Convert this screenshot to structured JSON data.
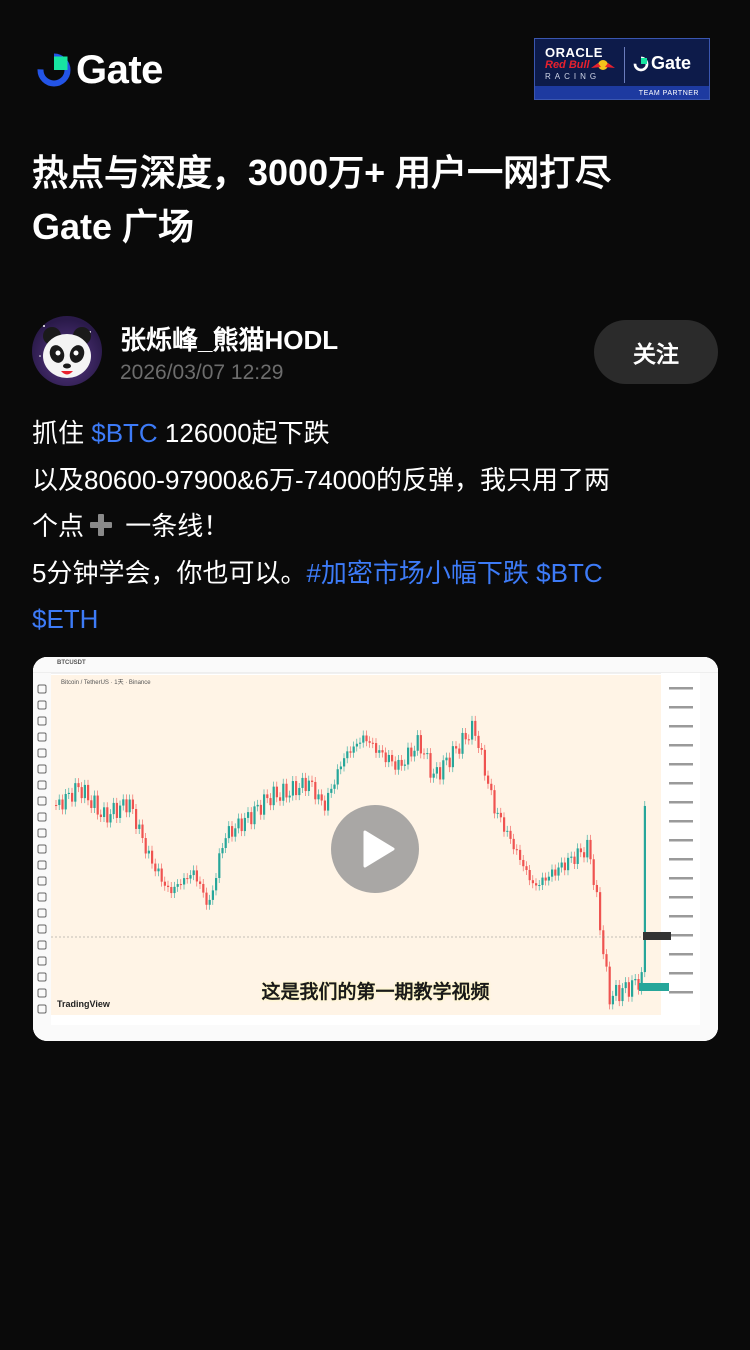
{
  "header": {
    "logo_text": "Gate",
    "partner": {
      "oracle": "ORACLE",
      "red_bull": "Red Bull",
      "racing": "RACING",
      "gate": "Gate",
      "team_partner": "TEAM PARTNER"
    }
  },
  "headline": {
    "line1": "热点与深度，3000万+ 用户一网打尽",
    "line2": "Gate 广场"
  },
  "author": {
    "name": "张烁峰_熊猫HODL",
    "timestamp": "2026/03/07 12:29",
    "follow_label": "关注"
  },
  "post": {
    "l1_prefix": "抓住 ",
    "l1_tag": "$BTC",
    "l1_suffix": " 126000起下跌",
    "l2": "以及80600-97900&6万-74000的反弹，我只用了两",
    "l3_prefix": "个点",
    "l3_suffix": " 一条线！",
    "l4_prefix": "5分钟学会，你也可以。",
    "l4_hashtag": "#加密市场小幅下跌",
    "l4_tag": " $BTC",
    "l5_tag": "$ETH"
  },
  "video": {
    "subtitle": "这是我们的第一期教学视频",
    "watermark": "TradingView",
    "chart_title": "Bitcoin / TetherUS · 1天 · Binance",
    "symbol": "BTCUSDT"
  },
  "icons": {
    "plus": "heavy-plus-icon",
    "play": "play-icon"
  },
  "colors": {
    "background": "#0a0a0a",
    "link": "#3d7bf7",
    "brand_blue": "#2354e6",
    "brand_green": "#17e5a1",
    "chart_up": "#26a69a",
    "chart_down": "#ef5350"
  }
}
